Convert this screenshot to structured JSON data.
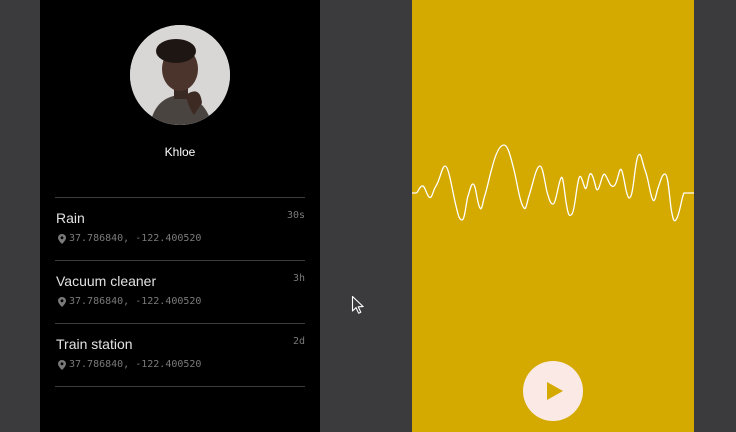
{
  "profile": {
    "name": "Khloe"
  },
  "sounds": [
    {
      "title": "Rain",
      "time": "30s",
      "coords": "37.786840, -122.400520"
    },
    {
      "title": "Vacuum cleaner",
      "time": "3h",
      "coords": "37.786840, -122.400520"
    },
    {
      "title": "Train station",
      "time": "2d",
      "coords": "37.786840, -122.400520"
    }
  ],
  "player": {
    "icon": "play-icon"
  },
  "colors": {
    "accent": "#d4a900",
    "play_button": "#fbe9e6",
    "list_background": "#000000"
  }
}
